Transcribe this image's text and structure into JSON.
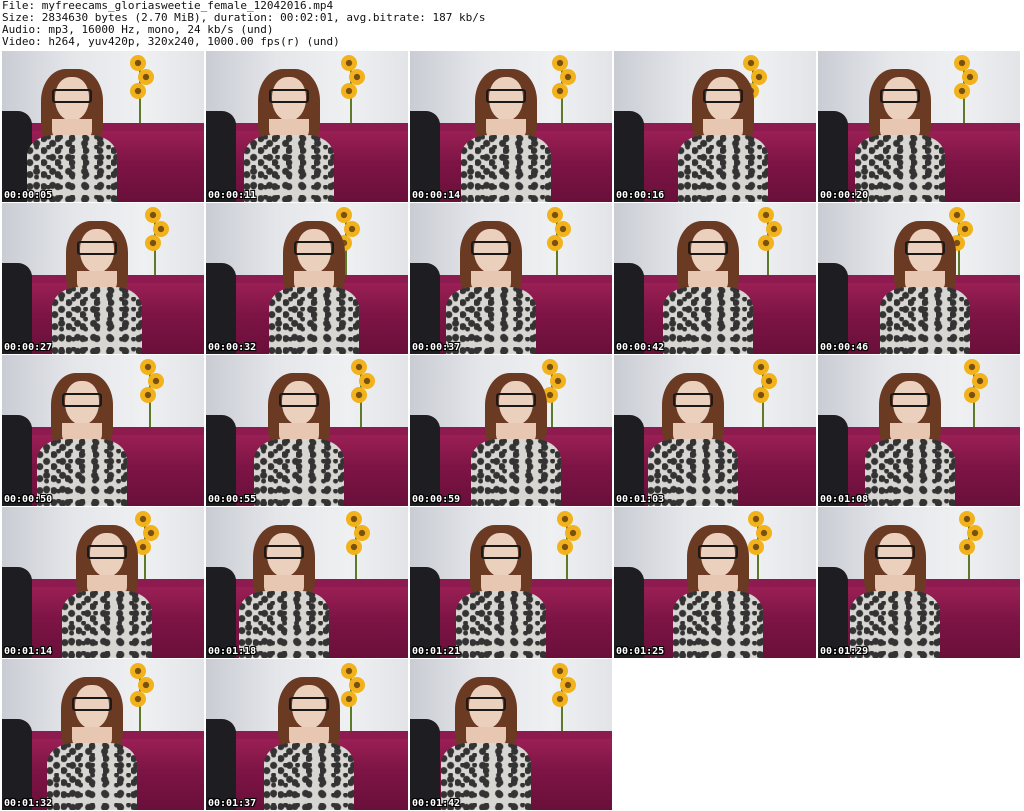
{
  "header": {
    "file_line": "File: myfreecams_gloriasweetie_female_12042016.mp4",
    "size_line": "Size: 2834630 bytes (2.70 MiB), duration: 00:02:01, avg.bitrate: 187 kb/s",
    "audio_line": "Audio: mp3, 16000 Hz, mono, 24 kb/s (und)",
    "video_line": "Video: h264, yuv420p, 320x240, 1000.00 fps(r) (und)"
  },
  "colors": {
    "sofa": "#7d1445",
    "wall": "#e4e6ea",
    "flower": "#f2b21b",
    "chair": "#1e1e22",
    "timestamp_text": "#ffffff"
  },
  "thumbnails": [
    {
      "time": "00:00:05"
    },
    {
      "time": "00:00:11"
    },
    {
      "time": "00:00:14"
    },
    {
      "time": "00:00:16"
    },
    {
      "time": "00:00:20"
    },
    {
      "time": "00:00:27"
    },
    {
      "time": "00:00:32"
    },
    {
      "time": "00:00:37"
    },
    {
      "time": "00:00:42"
    },
    {
      "time": "00:00:46"
    },
    {
      "time": "00:00:50"
    },
    {
      "time": "00:00:55"
    },
    {
      "time": "00:00:59"
    },
    {
      "time": "00:01:03"
    },
    {
      "time": "00:01:08"
    },
    {
      "time": "00:01:14"
    },
    {
      "time": "00:01:18"
    },
    {
      "time": "00:01:21"
    },
    {
      "time": "00:01:25"
    },
    {
      "time": "00:01:29"
    },
    {
      "time": "00:01:32"
    },
    {
      "time": "00:01:37"
    },
    {
      "time": "00:01:42"
    }
  ]
}
